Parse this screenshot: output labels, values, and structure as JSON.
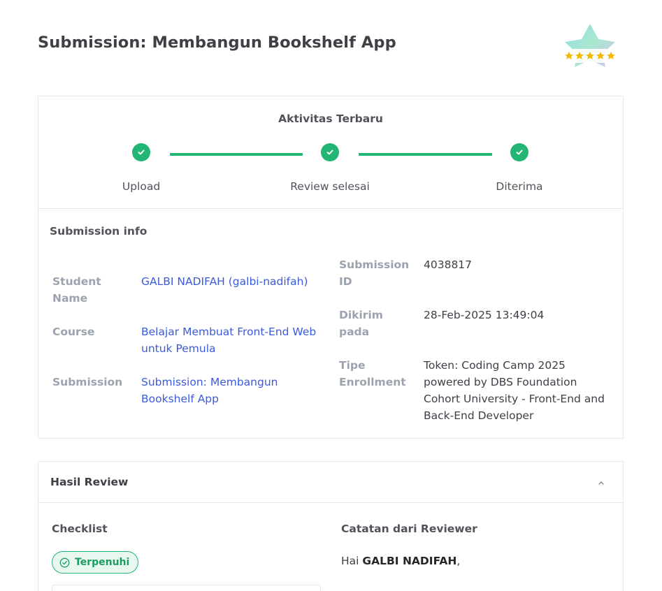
{
  "page": {
    "title": "Submission: Membangun Bookshelf App"
  },
  "activity": {
    "title": "Aktivitas Terbaru",
    "steps": [
      {
        "label": "Upload",
        "done": true
      },
      {
        "label": "Review selesai",
        "done": true
      },
      {
        "label": "Diterima",
        "done": true
      }
    ],
    "accent_color": "#22b573"
  },
  "submission_info": {
    "title": "Submission info",
    "left": {
      "student_label": "Student Name",
      "student_value": "GALBI NADIFAH (galbi-nadifah)",
      "course_label": "Course",
      "course_value": "Belajar Membuat Front-End Web untuk Pemula",
      "submission_label": "Submission",
      "submission_value": "Submission: Membangun Bookshelf App"
    },
    "right": {
      "id_label": "Submission ID",
      "id_value": "4038817",
      "sent_label": "Dikirim pada",
      "sent_value": "28-Feb-2025 13:49:04",
      "enroll_label": "Tipe Enrollment",
      "enroll_value": "Token: Coding Camp 2025 powered by DBS Foundation Cohort University - Front-End and Back-End Developer"
    }
  },
  "review": {
    "title": "Hasil Review",
    "checklist_title": "Checklist",
    "status_pill": "Terpenuhi",
    "notes_title": "Catatan dari Reviewer",
    "greeting_prefix": "Hai ",
    "greeting_name": "GALBI NADIFAH",
    "greeting_suffix": ","
  },
  "badge": {
    "icon": "five-star-rating-badge"
  }
}
